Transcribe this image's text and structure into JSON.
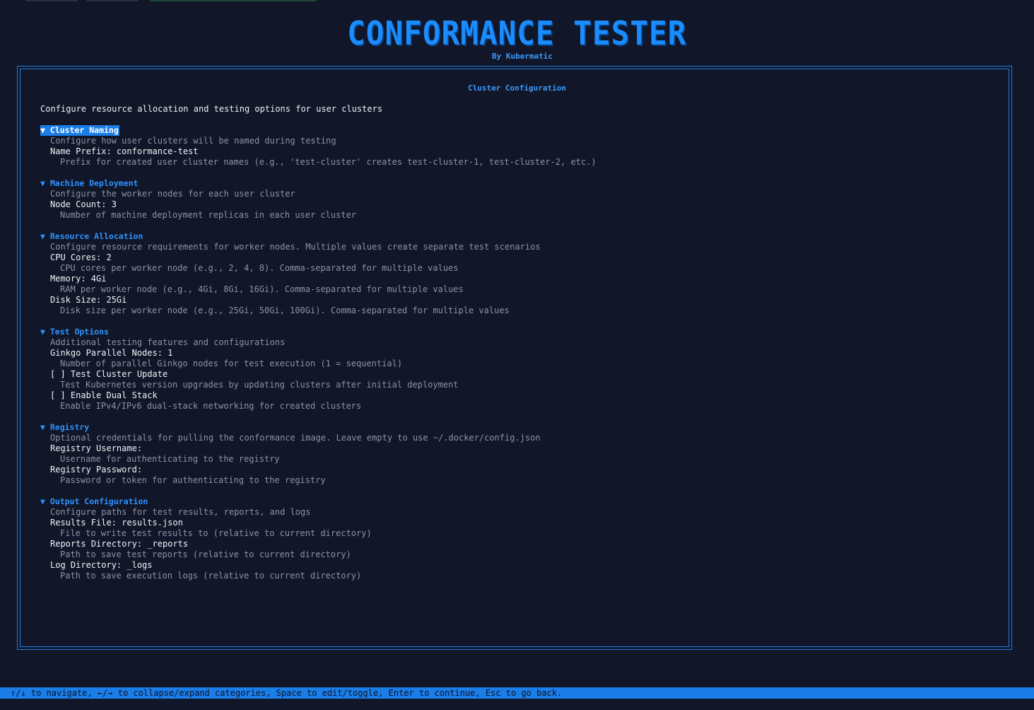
{
  "header": {
    "title": "CONFORMANCE TESTER",
    "subtitle": "By Kubermatic"
  },
  "panel": {
    "title": "Cluster Configuration",
    "intro": "Configure resource allocation and testing options for user clusters"
  },
  "categories": {
    "cluster_naming": {
      "label": "▼ Cluster Naming",
      "description": "Configure how user clusters will be named during testing",
      "fields": {
        "name_prefix": "Name Prefix: conformance-test",
        "name_prefix_help": "Prefix for created user cluster names (e.g., 'test-cluster' creates test-cluster-1, test-cluster-2, etc.)"
      }
    },
    "machine_deployment": {
      "label": "▼ Machine Deployment",
      "description": "Configure the worker nodes for each user cluster",
      "fields": {
        "node_count": "Node Count: 3",
        "node_count_help": "Number of machine deployment replicas in each user cluster"
      }
    },
    "resource_allocation": {
      "label": "▼ Resource Allocation",
      "description": "Configure resource requirements for worker nodes. Multiple values create separate test scenarios",
      "fields": {
        "cpu": "CPU Cores: 2",
        "cpu_help": "CPU cores per worker node (e.g., 2, 4, 8). Comma-separated for multiple values",
        "memory": "Memory: 4Gi",
        "memory_help": "RAM per worker node (e.g., 4Gi, 8Gi, 16Gi). Comma-separated for multiple values",
        "disk": "Disk Size: 25Gi",
        "disk_help": "Disk size per worker node (e.g., 25Gi, 50Gi, 100Gi). Comma-separated for multiple values"
      }
    },
    "test_options": {
      "label": "▼ Test Options",
      "description": "Additional testing features and configurations",
      "fields": {
        "ginkgo": "Ginkgo Parallel Nodes: 1",
        "ginkgo_help": "Number of parallel Ginkgo nodes for test execution (1 = sequential)",
        "cluster_update": "[ ] Test Cluster Update",
        "cluster_update_help": "Test Kubernetes version upgrades by updating clusters after initial deployment",
        "dual_stack": "[ ] Enable Dual Stack",
        "dual_stack_help": "Enable IPv4/IPv6 dual-stack networking for created clusters"
      }
    },
    "registry": {
      "label": "▼ Registry",
      "description": "Optional credentials for pulling the conformance image. Leave empty to use ~/.docker/config.json",
      "fields": {
        "username": "Registry Username:",
        "username_help": "Username for authenticating to the registry",
        "password": "Registry Password:",
        "password_help": "Password or token for authenticating to the registry"
      }
    },
    "output": {
      "label": "▼ Output Configuration",
      "description": "Configure paths for test results, reports, and logs",
      "fields": {
        "results": "Results File: results.json",
        "results_help": "File to write test results to (relative to current directory)",
        "reports": "Reports Directory: _reports",
        "reports_help": "Path to save test reports (relative to current directory)",
        "logs": "Log Directory: _logs",
        "logs_help": "Path to save execution logs (relative to current directory)"
      }
    }
  },
  "statusbar": {
    "help": "↑/↓ to navigate, ←/→ to collapse/expand categories, Space to edit/toggle, Enter to continue, Esc to go back."
  },
  "colors": {
    "background": "#111628",
    "accent": "#1a7de8",
    "description": "#8c94a6"
  }
}
